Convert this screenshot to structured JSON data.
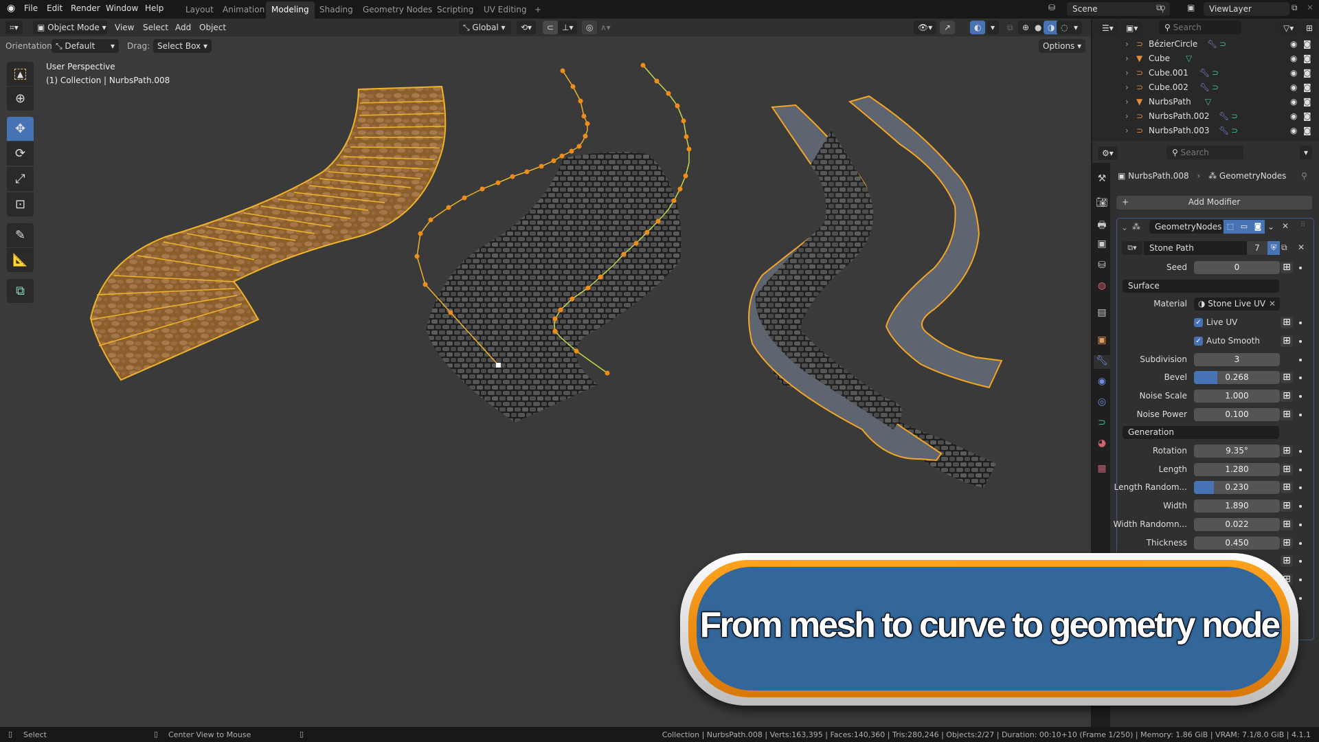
{
  "app": {
    "name": "Blender",
    "version": "4.1.1"
  },
  "menu": [
    "File",
    "Edit",
    "Render",
    "Window",
    "Help"
  ],
  "workspaces": [
    {
      "label": "Layout",
      "active": false
    },
    {
      "label": "Animation",
      "active": false
    },
    {
      "label": "Modeling",
      "active": true
    },
    {
      "label": "Shading",
      "active": false
    },
    {
      "label": "Geometry Nodes",
      "active": false
    },
    {
      "label": "Scripting",
      "active": false
    },
    {
      "label": "UV Editing",
      "active": false
    },
    {
      "label": "+",
      "active": false
    }
  ],
  "scene": {
    "name": "Scene",
    "view_layer": "ViewLayer"
  },
  "viewport_header": {
    "mode": "Object Mode",
    "menus": [
      "View",
      "Select",
      "Add",
      "Object"
    ],
    "transform_orientation": "Global",
    "options_label": "Options"
  },
  "tool_settings": {
    "orientation_label": "Orientation:",
    "orientation_value": "Default",
    "drag_label": "Drag:",
    "drag_value": "Select Box"
  },
  "viewport": {
    "view_name": "User Perspective",
    "context": "(1) Collection | NurbsPath.008",
    "tools": [
      "select-box",
      "cursor",
      "move",
      "rotate",
      "scale",
      "transform",
      "annotate",
      "measure",
      "add-cube"
    ],
    "active_tool": "move",
    "objects": [
      {
        "name": "mesh path",
        "state": "selected"
      },
      {
        "name": "curve path",
        "state": "active-curve"
      },
      {
        "name": "geometry node path",
        "state": "selected"
      }
    ],
    "colors": {
      "selection": "#f5a623",
      "active": "#ffaa33",
      "background": "#3a3a3a"
    }
  },
  "outliner": {
    "search_placeholder": "Search",
    "items": [
      {
        "name": "BézierCircle",
        "type": "curve",
        "modifiers": true,
        "data": "curve"
      },
      {
        "name": "Cube",
        "type": "mesh",
        "modifiers": false,
        "data": "mesh"
      },
      {
        "name": "Cube.001",
        "type": "curve",
        "modifiers": true,
        "data": "curve"
      },
      {
        "name": "Cube.002",
        "type": "curve",
        "modifiers": true,
        "data": "curve"
      },
      {
        "name": "NurbsPath",
        "type": "mesh",
        "modifiers": false,
        "data": "mesh"
      },
      {
        "name": "NurbsPath.002",
        "type": "curve",
        "modifiers": true,
        "data": "curve"
      },
      {
        "name": "NurbsPath.003",
        "type": "curve",
        "modifiers": true,
        "data": "curve"
      }
    ]
  },
  "properties": {
    "search_placeholder": "Search",
    "breadcrumb": [
      "NurbsPath.008",
      "GeometryNodes"
    ],
    "add_modifier_label": "Add Modifier",
    "modifier": {
      "name": "GeometryNodes",
      "node_group": "Stone Path",
      "users": "7",
      "fields": [
        {
          "label": "Seed",
          "value": "0",
          "type": "number"
        },
        {
          "section": "Surface"
        },
        {
          "label": "Material",
          "value": "Stone Live UV",
          "type": "material"
        },
        {
          "label": "Live UV",
          "value": true,
          "type": "checkbox"
        },
        {
          "label": "Auto Smooth",
          "value": true,
          "type": "checkbox"
        },
        {
          "label": "Subdivision",
          "value": "3",
          "type": "number"
        },
        {
          "label": "Bevel",
          "value": "0.268",
          "type": "slider",
          "fraction": 0.268
        },
        {
          "label": "Noise Scale",
          "value": "1.000",
          "type": "number"
        },
        {
          "label": "Noise Power",
          "value": "0.100",
          "type": "number"
        },
        {
          "section": "Generation"
        },
        {
          "label": "Rotation",
          "value": "9.35°",
          "type": "number"
        },
        {
          "label": "Length",
          "value": "1.280",
          "type": "number"
        },
        {
          "label": "Length Random...",
          "value": "0.230",
          "type": "slider",
          "fraction": 0.23
        },
        {
          "label": "Width",
          "value": "1.890",
          "type": "number"
        },
        {
          "label": "Width Randomn...",
          "value": "0.022",
          "type": "number"
        },
        {
          "label": "Thickness",
          "value": "0.450",
          "type": "number"
        }
      ]
    }
  },
  "status_bar": {
    "left": [
      {
        "icon": "mouse-left",
        "label": "Select"
      },
      {
        "icon": "mouse-middle",
        "label": "Center View to Mouse"
      },
      {
        "icon": "mouse-right",
        "label": ""
      }
    ],
    "stats": "Collection | NurbsPath.008 | Verts:163,395 | Faces:140,360 | Tris:280,246 | Objects:2/27 | Duration: 00:10+10 (Frame 1/250) | Memory: 1.86 GiB | VRAM: 7.1/8.0 GiB | 4.1.1"
  },
  "banner": {
    "text": "From mesh to curve to geometry node",
    "colors": {
      "fill": "#336699",
      "ring": "#f5961a",
      "rim": "#f0f0f0"
    }
  }
}
